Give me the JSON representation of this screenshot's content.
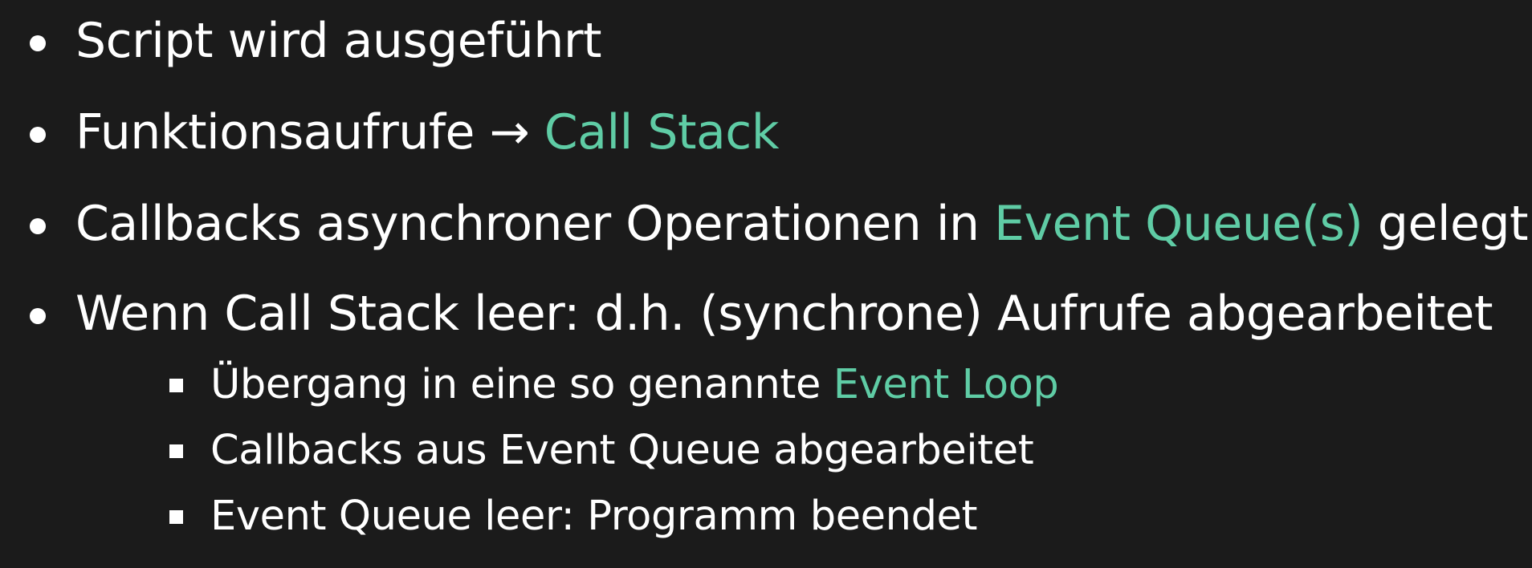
{
  "accent_color": "#5fcca5",
  "background_color": "#1b1b1b",
  "items": [
    {
      "text": "Script wird ausgeführt",
      "highlight": "",
      "after": ""
    },
    {
      "text": "Funktionsaufrufe → ",
      "highlight": "Call Stack",
      "after": ""
    },
    {
      "text": "Callbacks asynchroner Operationen in ",
      "highlight": "Event Queue(s)",
      "after": " gelegt"
    },
    {
      "text": "Wenn Call Stack leer: d.h. (synchrone) Aufrufe abgearbeitet",
      "highlight": "",
      "after": ""
    }
  ],
  "sub_items": [
    {
      "text": "Übergang in eine so genannte ",
      "highlight": "Event Loop"
    },
    {
      "text": "Callbacks aus Event Queue abgearbeitet",
      "highlight": ""
    },
    {
      "text": "Event Queue leer: Programm beendet",
      "highlight": ""
    }
  ]
}
